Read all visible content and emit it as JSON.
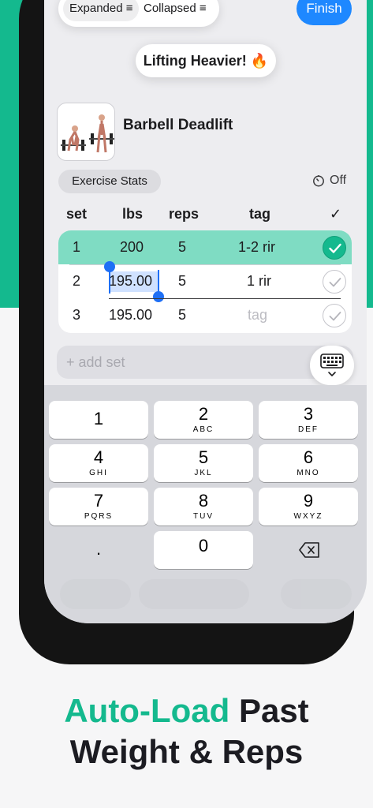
{
  "toolbar": {
    "expanded_label": "Expanded ≡",
    "collapsed_label": "Collapsed ≡",
    "finish_label": "Finish"
  },
  "toast": {
    "text": "Lifting Heavier! 🔥"
  },
  "exercise": {
    "name": "Barbell Deadlift",
    "stats_label": "Exercise Stats",
    "timer_label": "Off"
  },
  "table": {
    "headers": {
      "set": "set",
      "weight": "lbs",
      "reps": "reps",
      "tag": "tag",
      "check": "✓"
    },
    "rows": [
      {
        "set": "1",
        "weight": "200",
        "reps": "5",
        "tag": "1-2 rir",
        "tag_placeholder": false,
        "done": true
      },
      {
        "set": "2",
        "weight": "195.00",
        "reps": "5",
        "tag": "1 rir",
        "tag_placeholder": false,
        "done": false
      },
      {
        "set": "3",
        "weight": "195.00",
        "reps": "5",
        "tag": "tag",
        "tag_placeholder": true,
        "done": false
      }
    ]
  },
  "add_set": {
    "placeholder": "+ add set"
  },
  "keypad": {
    "keys": [
      {
        "num": "1",
        "letters": ""
      },
      {
        "num": "2",
        "letters": "ABC"
      },
      {
        "num": "3",
        "letters": "DEF"
      },
      {
        "num": "4",
        "letters": "GHI"
      },
      {
        "num": "5",
        "letters": "JKL"
      },
      {
        "num": "6",
        "letters": "MNO"
      },
      {
        "num": "7",
        "letters": "PQRS"
      },
      {
        "num": "8",
        "letters": "TUV"
      },
      {
        "num": "9",
        "letters": "WXYZ"
      },
      {
        "num": ".",
        "letters": ""
      },
      {
        "num": "0",
        "letters": ""
      }
    ]
  },
  "headline": {
    "accent": "Auto-Load",
    "rest_line1": " Past",
    "line2": "Weight & Reps"
  },
  "colors": {
    "brand_green": "#14b98e",
    "finish_blue": "#1e88ff",
    "completed_row": "#7fdcc3"
  }
}
